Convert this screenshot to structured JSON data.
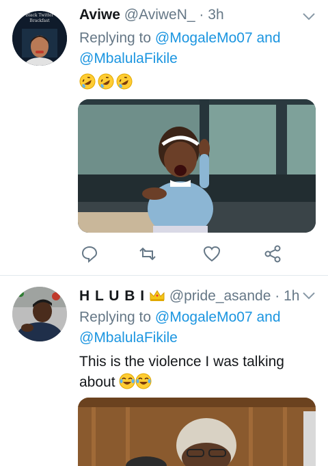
{
  "tweets": [
    {
      "name": "Aviwe",
      "handle": "@AviweN_",
      "dot": "·",
      "time": "3h",
      "reply_prefix": "Replying to",
      "mention1": "@MogaleMo07",
      "and": "and",
      "mention2": "@MbalulaFikile",
      "avatar_text_line1": "Black Twitter",
      "avatar_text_line2": "Brackfast",
      "emojis": [
        "rolling-on-floor-laughing",
        "rolling-on-floor-laughing",
        "rolling-on-floor-laughing"
      ],
      "media": "photo of laughing toddler in blue sweater by window"
    },
    {
      "name": "H L U B I",
      "name_badge": "crown-emoji",
      "handle": "@pride_asande",
      "dot": "·",
      "time": "1h",
      "reply_prefix": "Replying to",
      "mention1": "@MogaleMo07",
      "and": "and",
      "mention2": "@MbalulaFikile",
      "text_line1": "This is the violence I was talking",
      "text_line2": "about",
      "emojis": [
        "face-with-tears-of-joy",
        "face-with-tears-of-joy"
      ],
      "media": "photo of elderly man with white hair in courtroom"
    }
  ],
  "actions": [
    "reply-icon",
    "retweet-icon",
    "like-icon",
    "share-icon"
  ],
  "colors": {
    "link": "#1b95e0",
    "secondary": "#657786",
    "divider": "#e1e8ed",
    "text": "#14171a"
  }
}
